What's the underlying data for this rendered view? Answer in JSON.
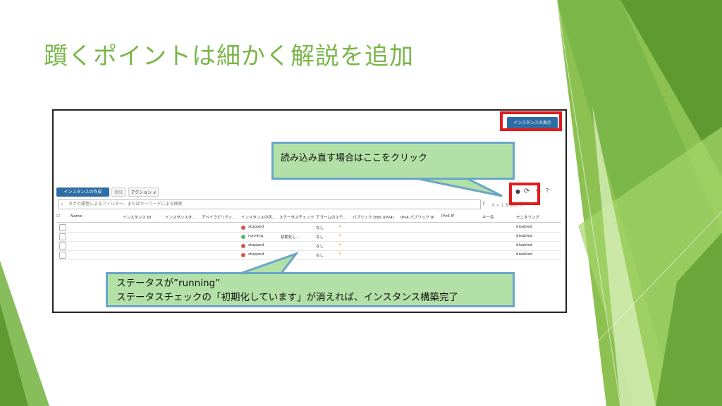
{
  "slide": {
    "title": "躓くポイントは細かく解説を追加"
  },
  "console": {
    "view_instances_button": "インスタンスの表示",
    "toolbar": {
      "create_label": "インスタンスの作成",
      "connect_label": "接続",
      "actions_label": "アクション ∨"
    },
    "filter_placeholder": "タグや属性によるフィルター、またはキーワードによる検索",
    "pager": "K < 1 を選択 >",
    "columns": [
      "Name",
      "インスタンス ID",
      "インスタンスタ…",
      "アベイラビリティ…",
      "インスタンスの状…",
      "ステータスチェック",
      "アラームのステ…",
      "パブリック DNS (IPv4)",
      "IPv4 パブリック IP",
      "IPv6 IP",
      "キー名",
      "モニタリング"
    ],
    "rows": [
      {
        "state": "stopped",
        "state_color": "#d9534f",
        "status": "",
        "alarm": "なし",
        "monitoring": "disabled"
      },
      {
        "state": "running",
        "state_color": "#5cb85c",
        "status": "初期化し…",
        "alarm": "なし",
        "monitoring": "disabled"
      },
      {
        "state": "stopped",
        "state_color": "#d9534f",
        "status": "",
        "alarm": "なし",
        "monitoring": "disabled"
      },
      {
        "state": "stopped",
        "state_color": "#d9534f",
        "status": "",
        "alarm": "なし",
        "monitoring": "disabled"
      }
    ]
  },
  "callouts": {
    "reload_hint": "読み込み直す場合はここをクリック",
    "status_hint_line1": "ステータスが”running”",
    "status_hint_line2": "ステータスチェックの「初期化しています」が消えれば、インスタンス構築完了"
  },
  "colors": {
    "title": "#7ab648",
    "callout_fill": "#b3e0a6",
    "callout_border": "#6aa6c9",
    "highlight": "#e21b1b",
    "primary_button": "#2e6da4"
  }
}
